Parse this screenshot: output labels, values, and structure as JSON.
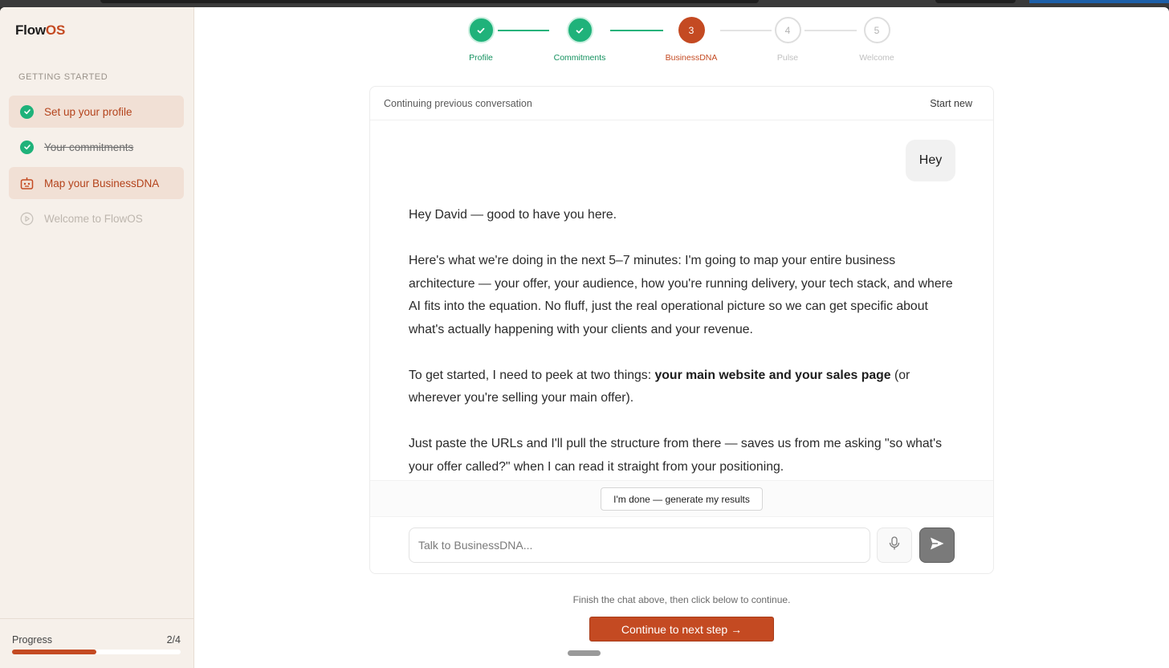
{
  "brand": {
    "name_prefix": "Flow",
    "name_suffix": "OS"
  },
  "colors": {
    "accent": "#c44a22",
    "success": "#1fb27a",
    "sidebar_bg": "#f6f0ea",
    "active_item_bg": "#f1e0d5"
  },
  "sidebar": {
    "section_label": "GETTING STARTED",
    "items": [
      {
        "label": "Set up your profile",
        "icon": "check-circle-icon",
        "state": "active-done"
      },
      {
        "label": "Your commitments",
        "icon": "check-circle-icon",
        "state": "done"
      },
      {
        "label": "Map your BusinessDNA",
        "icon": "robot-icon",
        "state": "current"
      },
      {
        "label": "Welcome to FlowOS",
        "icon": "play-circle-icon",
        "state": "disabled"
      }
    ],
    "progress": {
      "label": "Progress",
      "count": "2/4",
      "fraction": 0.5
    }
  },
  "stepper": {
    "steps": [
      {
        "number": "1",
        "label": "Profile",
        "state": "done"
      },
      {
        "number": "2",
        "label": "Commitments",
        "state": "done"
      },
      {
        "number": "3",
        "label": "BusinessDNA",
        "state": "current"
      },
      {
        "number": "4",
        "label": "Pulse",
        "state": "pending"
      },
      {
        "number": "5",
        "label": "Welcome",
        "state": "pending"
      }
    ]
  },
  "chat": {
    "status": "Continuing previous conversation",
    "start_new": "Start new",
    "user_message": "Hey",
    "assistant": {
      "p1": "Hey David — good to have you here.",
      "p2": "Here's what we're doing in the next 5–7 minutes: I'm going to map your entire business architecture — your offer, your audience, how you're running delivery, your tech stack, and where AI fits into the equation. No fluff, just the real operational picture so we can get specific about what's actually happening with your clients and your revenue.",
      "p3_before": "To get started, I need to peek at two things: ",
      "p3_bold": "your main website and your sales page",
      "p3_after": " (or wherever you're selling your main offer).",
      "p4": "Just paste the URLs and I'll pull the structure from there — saves us from me asking \"so what's your offer called?\" when I can read it straight from your positioning."
    },
    "done_button": "I'm done — generate my results",
    "input_placeholder": "Talk to BusinessDNA...",
    "input_value": ""
  },
  "footer": {
    "hint": "Finish the chat above, then click below to continue.",
    "continue_button": "Continue to next step →"
  }
}
